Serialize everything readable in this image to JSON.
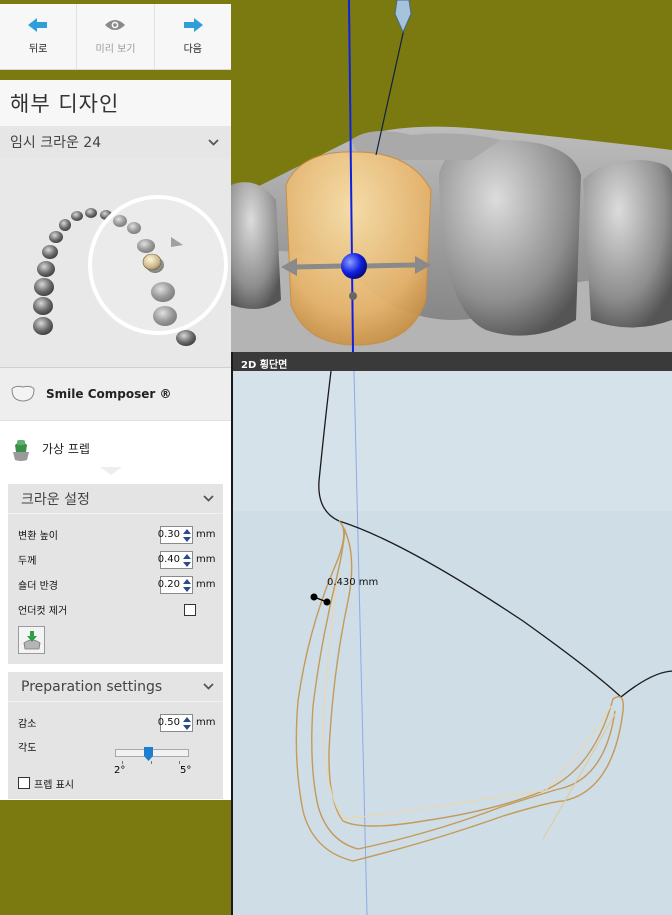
{
  "toolbar": {
    "back_label": "뒤로",
    "preview_label": "미리 보기",
    "next_label": "다음"
  },
  "panel": {
    "title": "해부 디자인",
    "tooth_selector": "임시 크라운 24",
    "smile_composer": "Smile Composer ®",
    "virtual_prep": "가상 프렙"
  },
  "crown_settings": {
    "title": "크라운 설정",
    "transition_height_label": "변환 높이",
    "transition_height_value": "0.30",
    "thickness_label": "두께",
    "thickness_value": "0.40",
    "shoulder_radius_label": "숄더 반경",
    "shoulder_radius_value": "0.20",
    "undercut_label": "언더컷 제거",
    "undercut_checked": false,
    "unit": "mm"
  },
  "prep_settings": {
    "title": "Preparation settings",
    "reduction_label": "감소",
    "reduction_value": "0.50",
    "angle_label": "각도",
    "angle_min": "2°",
    "angle_max": "5°",
    "angle_level": 0.45,
    "show_prep_label": "프렙 표시",
    "show_prep_checked": false,
    "unit": "mm"
  },
  "view2d": {
    "title": "2D 횡단면",
    "measurement": "0.430 mm"
  },
  "colors": {
    "background_olive": "#7b7a10",
    "accent_blue": "#2e9fd8",
    "crown_tan": "#e8b46a",
    "gizmo_blue": "#1020e0"
  }
}
